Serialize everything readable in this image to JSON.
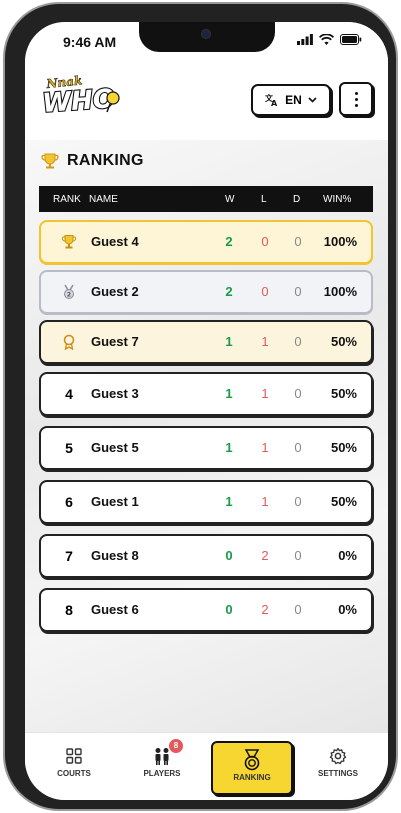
{
  "status_bar": {
    "time": "9:46 AM"
  },
  "header": {
    "logo_text_top": "Nnak",
    "logo_text_main": "WHO",
    "language": "EN"
  },
  "section": {
    "title": "RANKING"
  },
  "table": {
    "columns": [
      "RANK",
      "NAME",
      "W",
      "L",
      "D",
      "WIN%"
    ],
    "rows": [
      {
        "rank": "",
        "medal": "gold-trophy-icon",
        "name": "Guest 4",
        "w": "2",
        "l": "0",
        "d": "0",
        "pct": "100%"
      },
      {
        "rank": "",
        "medal": "silver-medal-icon",
        "name": "Guest 2",
        "w": "2",
        "l": "0",
        "d": "0",
        "pct": "100%"
      },
      {
        "rank": "",
        "medal": "bronze-medal-icon",
        "name": "Guest 7",
        "w": "1",
        "l": "1",
        "d": "0",
        "pct": "50%"
      },
      {
        "rank": "4",
        "name": "Guest 3",
        "w": "1",
        "l": "1",
        "d": "0",
        "pct": "50%"
      },
      {
        "rank": "5",
        "name": "Guest 5",
        "w": "1",
        "l": "1",
        "d": "0",
        "pct": "50%"
      },
      {
        "rank": "6",
        "name": "Guest 1",
        "w": "1",
        "l": "1",
        "d": "0",
        "pct": "50%"
      },
      {
        "rank": "7",
        "name": "Guest 8",
        "w": "0",
        "l": "2",
        "d": "0",
        "pct": "0%"
      },
      {
        "rank": "8",
        "name": "Guest 6",
        "w": "0",
        "l": "2",
        "d": "0",
        "pct": "0%"
      }
    ]
  },
  "nav": {
    "courts": "COURTS",
    "players": "PLAYERS",
    "players_badge": "8",
    "ranking": "RANKING",
    "settings": "SETTINGS"
  },
  "colors": {
    "accent": "#f8d631",
    "win": "#1a9a4a",
    "loss": "#e25a5a",
    "gold_border": "#f2c430"
  }
}
